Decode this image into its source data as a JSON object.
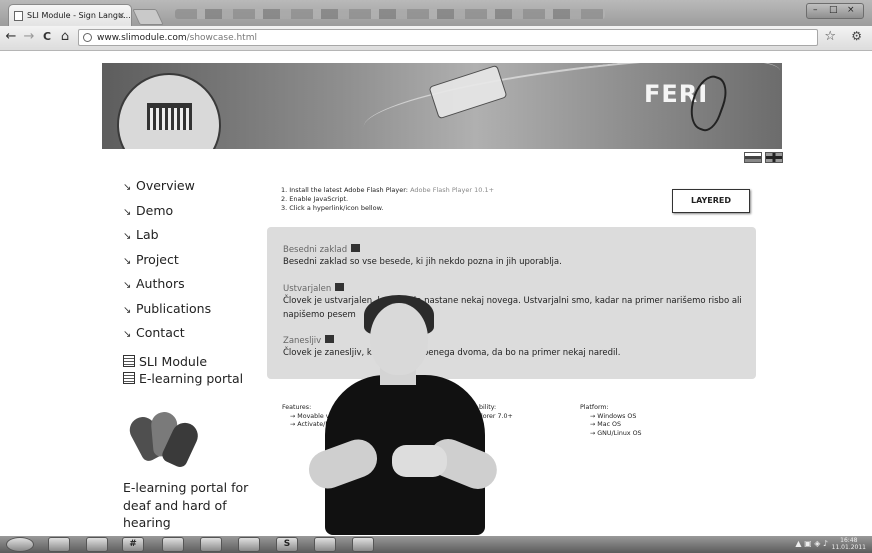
{
  "browser": {
    "tab_title": "SLI Module - Sign Langu...",
    "tab_close": "×",
    "url_host": "www.slimodule.com",
    "url_path": "/showcase.html",
    "back": "←",
    "forward": "→",
    "reload": "C",
    "home": "⌂",
    "bookmark": "☆",
    "menu": "⚙"
  },
  "banner": {
    "logo_text": "FERI"
  },
  "nav": {
    "items": [
      {
        "label": "Overview"
      },
      {
        "label": "Demo"
      },
      {
        "label": "Lab"
      },
      {
        "label": "Project"
      },
      {
        "label": "Authors"
      },
      {
        "label": "Publications"
      },
      {
        "label": "Contact"
      }
    ],
    "links": [
      {
        "label": "SLI Module"
      },
      {
        "label": "E-learning portal"
      }
    ],
    "tagline": "E-learning portal for deaf and hard of hearing"
  },
  "instructions": {
    "step1": "1. Install the latest Adobe Flash Player:",
    "step1_link": "Adobe Flash Player 10.1+",
    "step2": "2. Enable JavaScript.",
    "step3": "3. Click a hyperlink/icon bellow."
  },
  "layered_button": "LAYERED",
  "glossary": [
    {
      "title": "Besedni zaklad",
      "definition": "Besedni zaklad so vse besede, ki jih nekdo pozna in jih uporablja."
    },
    {
      "title": "Ustvarjalen",
      "definition": "Človek je ustvarjalen, kad              ko, da nastane nekaj novega. Ustvarjalni smo, kadar na primer narišemo risbo ali napišemo pesem"
    },
    {
      "title": "Zanesljiv",
      "definition": "Človek je zanesljiv, kadar                jem nobenega dvoma, da bo na primer nekaj naredil."
    }
  ],
  "features": {
    "heading": "Features:",
    "items": [
      "→ Movable vi",
      "→ Activate/D"
    ]
  },
  "compatibility": {
    "heading": "bility:",
    "items": [
      "",
      "lorer 7.0+"
    ]
  },
  "platform": {
    "heading": "Platform:",
    "items": [
      "→ Windows OS",
      "→ Mac OS",
      "→ GNU/Linux OS"
    ]
  },
  "taskbar": {
    "icons": [
      "",
      "",
      "",
      "#",
      "",
      "",
      "",
      "S",
      "",
      ""
    ],
    "clock_time": "16:48",
    "clock_date": "11.01.2011"
  }
}
